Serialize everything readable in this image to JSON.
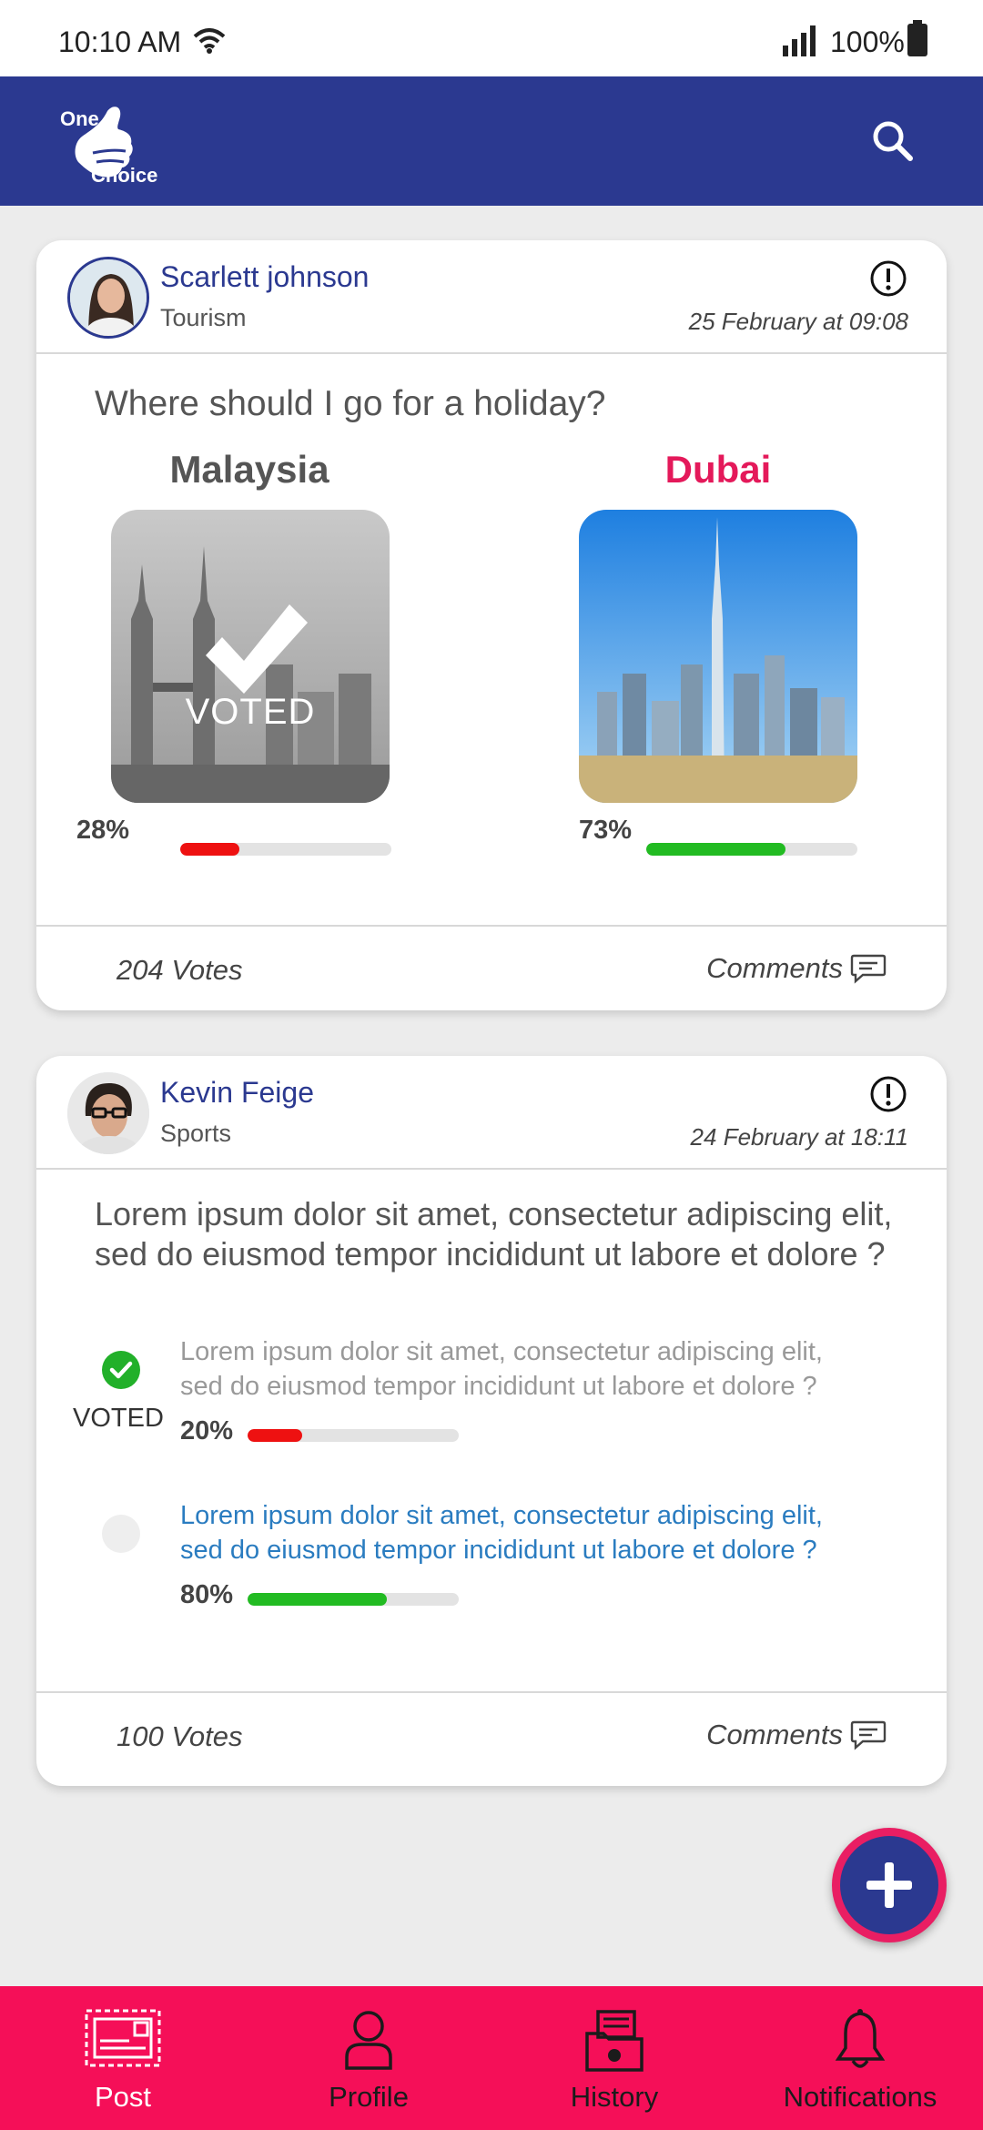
{
  "status_bar": {
    "time": "10:10 AM",
    "battery": "100%"
  },
  "header": {
    "logo_top": "One",
    "logo_bottom": "Choice"
  },
  "posts": [
    {
      "user": "Scarlett johnson",
      "category": "Tourism",
      "date": "25 February at 09:08",
      "question": "Where should I go for a holiday?",
      "options": [
        {
          "title": "Malaysia",
          "percent_label": "28%",
          "percent": 28,
          "voted": true,
          "voted_label": "VOTED",
          "title_color": "#555555",
          "bar_color": "#ee1111"
        },
        {
          "title": "Dubai",
          "percent_label": "73%",
          "percent": 66,
          "voted": false,
          "title_color": "#e4195a",
          "bar_color": "#22bb22"
        }
      ],
      "votes": "204 Votes",
      "comments": "Comments"
    },
    {
      "user": "Kevin Feige",
      "category": "Sports",
      "date": "24 February at 18:11",
      "question_line1": "Lorem ipsum dolor sit amet, consectetur adipiscing elit,",
      "question_line2": "sed do eiusmod tempor incididunt ut labore et dolore ?",
      "options": [
        {
          "line1": "Lorem ipsum dolor sit amet, consectetur adipiscing elit,",
          "line2": "sed do eiusmod tempor incididunt ut labore et dolore ?",
          "percent_label": "20%",
          "percent": 26,
          "voted": true,
          "voted_label": "VOTED",
          "text_color": "#999999",
          "bar_color": "#ee1111"
        },
        {
          "line1": "Lorem ipsum dolor sit amet, consectetur adipiscing elit,",
          "line2": "sed do eiusmod tempor incididunt ut labore et dolore ?",
          "percent_label": "80%",
          "percent": 66,
          "voted": false,
          "text_color": "#2a7cc0",
          "bar_color": "#22bb22"
        }
      ],
      "votes": "100 Votes",
      "comments": "Comments"
    }
  ],
  "nav": [
    {
      "label": "Post",
      "icon": "post-icon",
      "active": true
    },
    {
      "label": "Profile",
      "icon": "profile-icon",
      "active": false
    },
    {
      "label": "History",
      "icon": "history-icon",
      "active": false
    },
    {
      "label": "Notifications",
      "icon": "bell-icon",
      "active": false
    }
  ],
  "colors": {
    "primary": "#2b3990",
    "accent": "#f50f58",
    "fab_ring": "#e91e63"
  }
}
